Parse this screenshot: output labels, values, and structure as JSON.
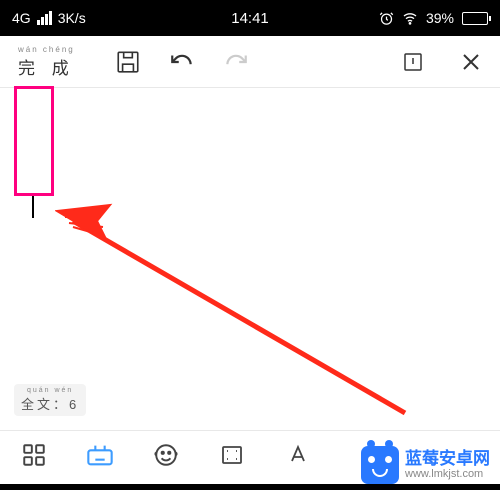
{
  "status": {
    "network": "4G",
    "speed": "3K/s",
    "time": "14:41",
    "battery_pct": "39%"
  },
  "toolbar": {
    "done_pinyin": "wán chéng",
    "done_label": "完 成"
  },
  "word_count": {
    "pinyin": "quán wén",
    "label": "全文：6"
  },
  "watermark": {
    "title": "蓝莓安卓网",
    "url": "www.lmkjst.com"
  }
}
